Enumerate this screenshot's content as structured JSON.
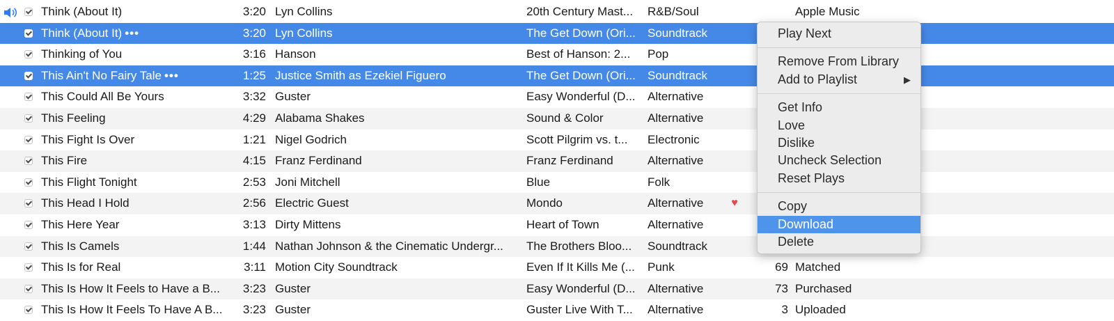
{
  "colors": {
    "selection": "#4589e8",
    "menu_highlight": "#4e94ea",
    "heart": "#e5484d",
    "speaker": "#3478f6"
  },
  "now_playing_icon": "speaker-icon",
  "songs": [
    {
      "title": "Think (About It)",
      "time": "3:20",
      "artist": "Lyn Collins",
      "album": "20th Century Mast...",
      "genre": "R&B/Soul",
      "plays": "",
      "kind": "Apple Music",
      "playing": true
    },
    {
      "title": "Think (About It)",
      "time": "3:20",
      "artist": "Lyn Collins",
      "album": "The Get Down (Ori...",
      "genre": "Soundtrack",
      "plays": "",
      "kind": "",
      "selected": true,
      "more": "•••"
    },
    {
      "title": "Thinking of You",
      "time": "3:16",
      "artist": "Hanson",
      "album": "Best of Hanson: 2...",
      "genre": "Pop",
      "plays": "",
      "kind": ""
    },
    {
      "title": "This Ain't No Fairy Tale",
      "time": "1:25",
      "artist": "Justice Smith as Ezekiel Figuero",
      "album": "The Get Down (Ori...",
      "genre": "Soundtrack",
      "plays": "",
      "kind": "",
      "selected": true,
      "more": "•••"
    },
    {
      "title": "This Could All Be Yours",
      "time": "3:32",
      "artist": "Guster",
      "album": "Easy Wonderful (D...",
      "genre": "Alternative",
      "plays": "",
      "kind": ""
    },
    {
      "title": "This Feeling",
      "time": "4:29",
      "artist": "Alabama Shakes",
      "album": "Sound & Color",
      "genre": "Alternative",
      "plays": "",
      "kind": ""
    },
    {
      "title": "This Fight Is Over",
      "time": "1:21",
      "artist": "Nigel Godrich",
      "album": "Scott Pilgrim vs. t...",
      "genre": "Electronic",
      "plays": "",
      "kind": ""
    },
    {
      "title": "This Fire",
      "time": "4:15",
      "artist": "Franz Ferdinand",
      "album": "Franz Ferdinand",
      "genre": "Alternative",
      "plays": "",
      "kind": ""
    },
    {
      "title": "This Flight Tonight",
      "time": "2:53",
      "artist": "Joni Mitchell",
      "album": "Blue",
      "genre": "Folk",
      "plays": "",
      "kind": ""
    },
    {
      "title": "This Head I Hold",
      "time": "2:56",
      "artist": "Electric Guest",
      "album": "Mondo",
      "genre": "Alternative",
      "plays": "",
      "kind": "",
      "loved": true,
      "heart": "♥"
    },
    {
      "title": "This Here Year",
      "time": "3:13",
      "artist": "Dirty Mittens",
      "album": "Heart of Town",
      "genre": "Alternative",
      "plays": "",
      "kind": ""
    },
    {
      "title": "This Is Camels",
      "time": "1:44",
      "artist": "Nathan Johnson & the Cinematic Undergr...",
      "album": "The Brothers Bloo...",
      "genre": "Soundtrack",
      "plays": "",
      "kind": ""
    },
    {
      "title": "This Is for Real",
      "time": "3:11",
      "artist": "Motion City Soundtrack",
      "album": "Even If It Kills Me (...",
      "genre": "Punk",
      "plays": "69",
      "kind": "Matched"
    },
    {
      "title": "This Is How It Feels to Have a B...",
      "time": "3:23",
      "artist": "Guster",
      "album": "Easy Wonderful (D...",
      "genre": "Alternative",
      "plays": "73",
      "kind": "Purchased"
    },
    {
      "title": "This Is How It Feels To Have A B...",
      "time": "3:23",
      "artist": "Guster",
      "album": "Guster Live With T...",
      "genre": "Alternative",
      "plays": "3",
      "kind": "Uploaded"
    }
  ],
  "context_menu": {
    "groups": [
      [
        "Play Next"
      ],
      [
        "Remove From Library",
        "Add to Playlist"
      ],
      [
        "Get Info",
        "Love",
        "Dislike",
        "Uncheck Selection",
        "Reset Plays"
      ],
      [
        "Copy",
        "Download",
        "Delete"
      ]
    ],
    "submenu_item": "Add to Playlist",
    "submenu_arrow": "▶",
    "highlighted": "Download"
  }
}
